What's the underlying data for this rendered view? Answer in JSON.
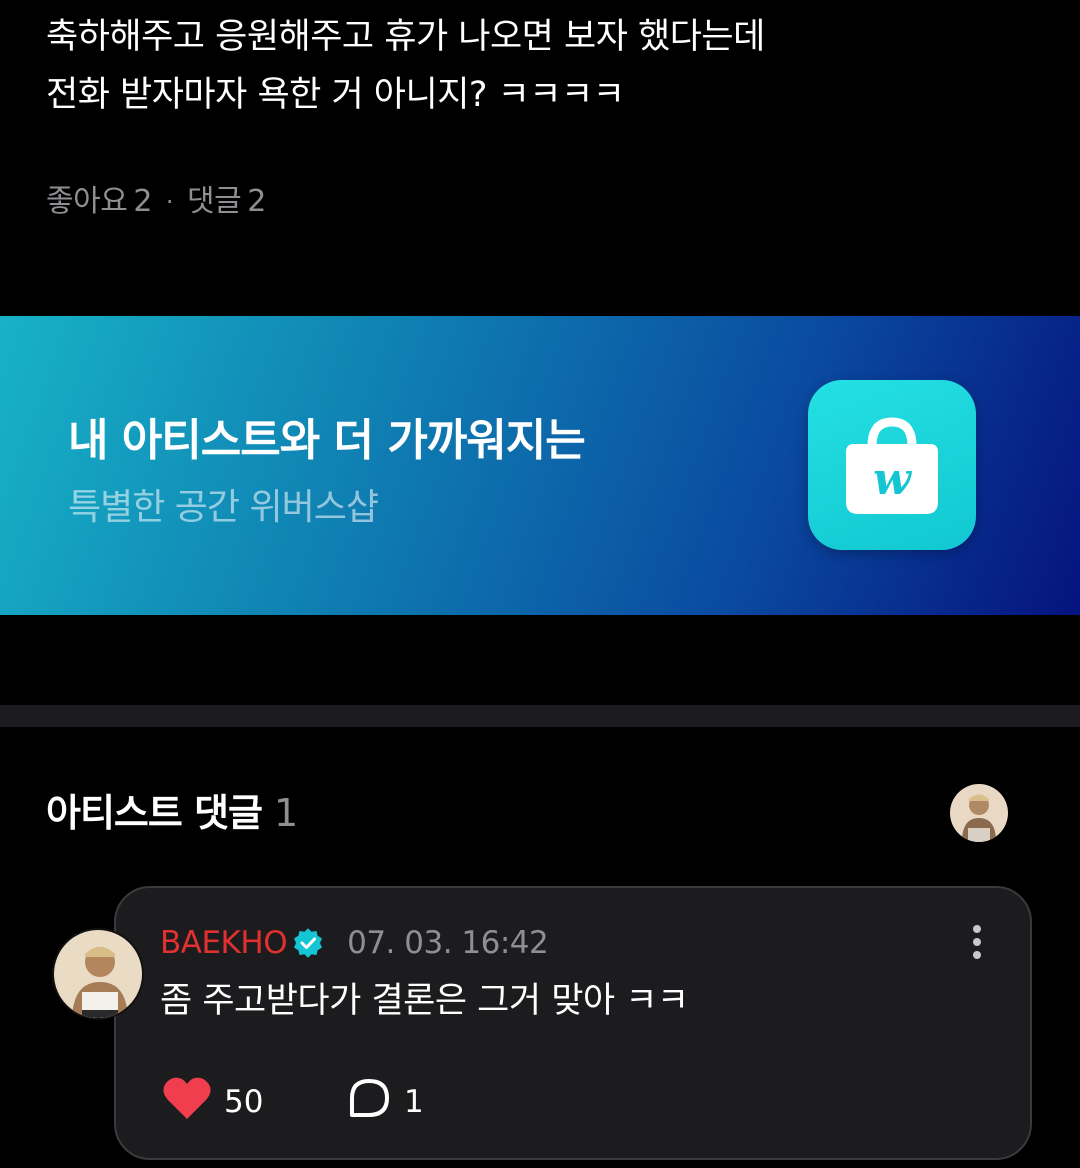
{
  "post": {
    "body_lines": [
      "축하해주고 응원해주고 휴가 나오면 보자 했다는데",
      "전화 받자마자 욕한 거 아니지?  ㅋㅋㅋㅋ"
    ],
    "likes_label": "좋아요",
    "likes_count": "2",
    "separator": "·",
    "comments_label": "댓글",
    "comments_count": "2"
  },
  "banner": {
    "title": "내 아티스트와 더 가까워지는",
    "subtitle": "특별한 공간 위버스샵",
    "icon": "weverse-shop-bag-icon",
    "icon_letter": "w"
  },
  "artist_comments": {
    "title": "아티스트 댓글",
    "count": "1"
  },
  "comment": {
    "author": "BAEKHO",
    "verified_icon": "verified-badge-icon",
    "timestamp": "07. 03. 16:42",
    "text": "좀 주고받다가 결론은 그거 맞아 ㅋㅋ",
    "like_count": "50",
    "reply_count": "1"
  },
  "colors": {
    "background": "#000000",
    "author": "#e0302f",
    "verified": "#14c6d4",
    "heart": "#f03e4f",
    "muted": "#8e8e93",
    "card": "#1c1c1e"
  }
}
